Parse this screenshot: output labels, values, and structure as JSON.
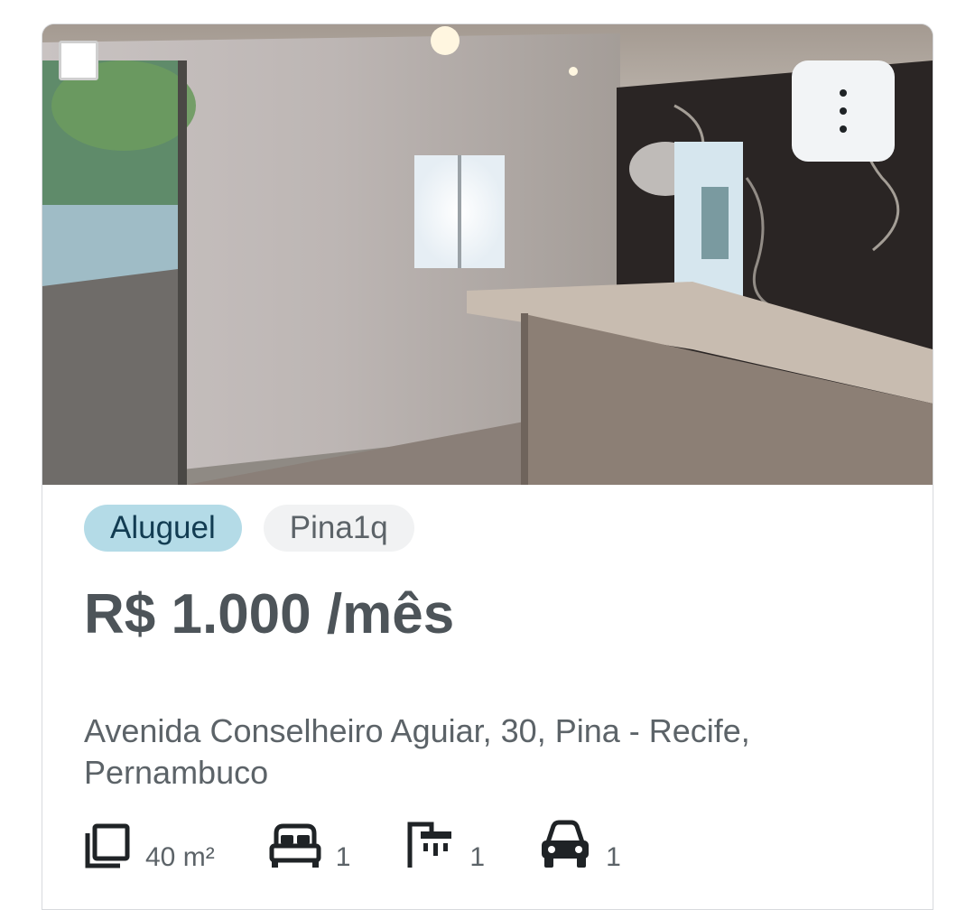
{
  "listing": {
    "tags": {
      "primary": "Aluguel",
      "secondary": "Pina1q"
    },
    "price": "R$ 1.000 /mês",
    "address": "Avenida Conselheiro Aguiar, 30, Pina - Recife, Pernambuco",
    "features": {
      "area": {
        "icon": "area-icon",
        "value": "40 m²"
      },
      "bedrooms": {
        "icon": "bed-icon",
        "value": "1"
      },
      "bathrooms": {
        "icon": "shower-icon",
        "value": "1"
      },
      "parking": {
        "icon": "car-icon",
        "value": "1"
      }
    }
  },
  "colors": {
    "tag_primary_bg": "#b4dbe7",
    "tag_primary_text": "#123c52",
    "tag_secondary_bg": "#f1f2f3",
    "price_text": "#4d5459",
    "body_text": "#5c6368"
  }
}
